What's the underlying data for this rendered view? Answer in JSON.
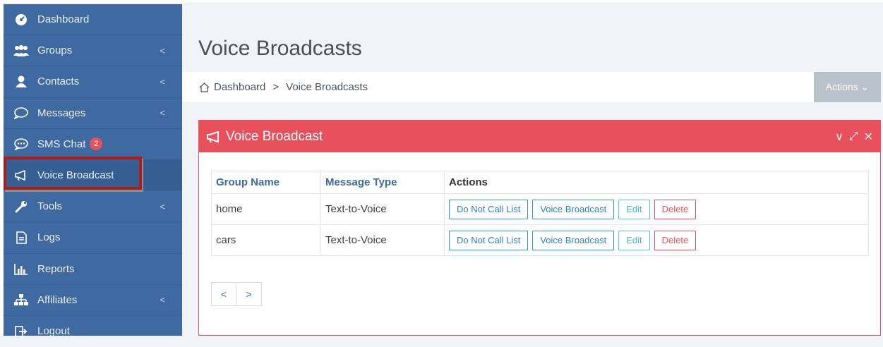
{
  "sidebar": {
    "items": [
      {
        "label": "Dashboard",
        "icon": "dashboard-icon",
        "has_chevron": false
      },
      {
        "label": "Groups",
        "icon": "users-icon",
        "has_chevron": true
      },
      {
        "label": "Contacts",
        "icon": "user-icon",
        "has_chevron": true
      },
      {
        "label": "Messages",
        "icon": "chat-bubble-icon",
        "has_chevron": true
      },
      {
        "label": "SMS Chat",
        "icon": "sms-chat-icon",
        "has_chevron": false,
        "badge": "2"
      },
      {
        "label": "Voice Broadcast",
        "icon": "megaphone-icon",
        "has_chevron": false,
        "active": true
      },
      {
        "label": "Tools",
        "icon": "wrench-icon",
        "has_chevron": true
      },
      {
        "label": "Logs",
        "icon": "document-icon",
        "has_chevron": false
      },
      {
        "label": "Reports",
        "icon": "bar-chart-icon",
        "has_chevron": false
      },
      {
        "label": "Affiliates",
        "icon": "sitemap-icon",
        "has_chevron": true
      },
      {
        "label": "Logout",
        "icon": "logout-icon",
        "has_chevron": false
      }
    ],
    "chevron": "<"
  },
  "header": {
    "title": "Voice Broadcasts"
  },
  "breadcrumb": {
    "home": "Dashboard",
    "separator": ">",
    "current": "Voice Broadcasts"
  },
  "actions_label": "Actions ⌄",
  "panel": {
    "title": "Voice Broadcast",
    "tools": [
      "∨",
      "⤢",
      "✕"
    ]
  },
  "table": {
    "headers": [
      "Group Name",
      "Message Type",
      "Actions"
    ],
    "rows": [
      {
        "group": "home",
        "type": "Text-to-Voice"
      },
      {
        "group": "cars",
        "type": "Text-to-Voice"
      }
    ],
    "buttons": {
      "dnc": "Do Not Call List",
      "broadcast": "Voice Broadcast",
      "edit": "Edit",
      "delete": "Delete"
    }
  },
  "pager": {
    "prev": "<",
    "next": ">"
  },
  "colors": {
    "sidebar": "#3f6aa1",
    "panel_accent": "#e8505b",
    "highlight": "#b01b1b"
  }
}
